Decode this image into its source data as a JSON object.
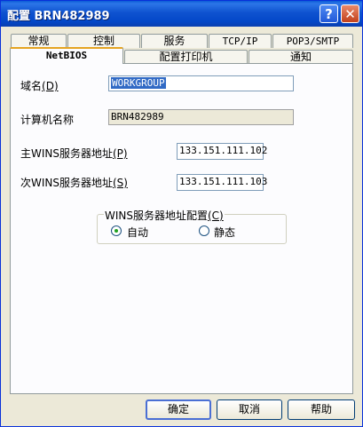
{
  "window": {
    "title": "配置 BRN482989",
    "help": "?",
    "close": "✕"
  },
  "tabs_row1": [
    {
      "label": "常规"
    },
    {
      "label": "控制"
    },
    {
      "label": "服务"
    },
    {
      "label": "TCP/IP"
    },
    {
      "label": "POP3/SMTP"
    }
  ],
  "tabs_row2": [
    {
      "label": "NetBIOS"
    },
    {
      "label": "配置打印机"
    },
    {
      "label": "通知"
    }
  ],
  "form": {
    "domain_label": "域名",
    "domain_key": "(D)",
    "domain_value": "WORKGROUP",
    "computer_label": "计算机名称",
    "computer_value": "BRN482989",
    "primary_label": "主WINS服务器地址",
    "primary_key": "(P)",
    "primary_value": "133.151.111.102",
    "secondary_label": "次WINS服务器地址",
    "secondary_key": "(S)",
    "secondary_value": "133.151.111.103"
  },
  "wins_config": {
    "title": "WINS服务器地址配置",
    "title_key": "(C)",
    "auto_label": "自动",
    "static_label": "静态",
    "selected": "auto"
  },
  "buttons": {
    "ok": "确定",
    "cancel": "取消",
    "help": "帮助"
  }
}
